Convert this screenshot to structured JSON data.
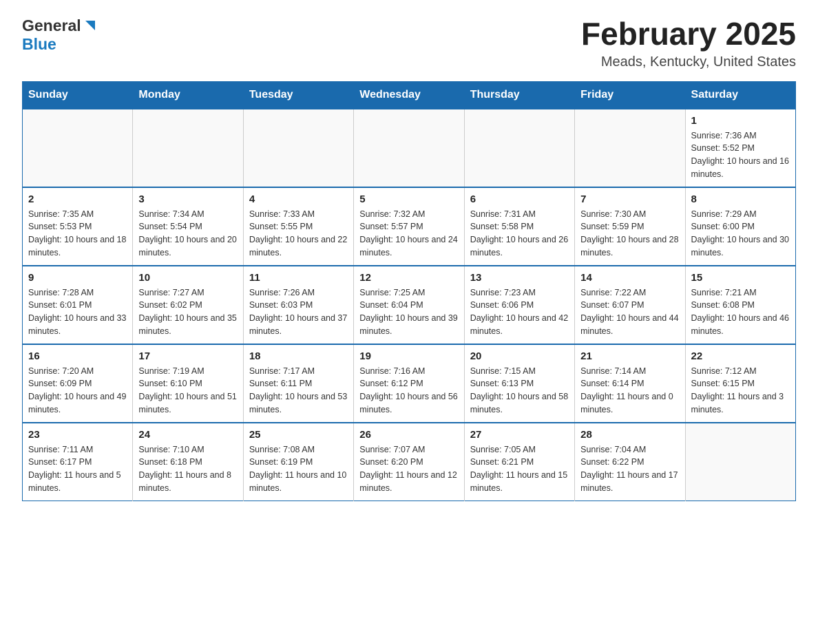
{
  "header": {
    "logo_general": "General",
    "logo_blue": "Blue",
    "month_title": "February 2025",
    "location": "Meads, Kentucky, United States"
  },
  "days_of_week": [
    "Sunday",
    "Monday",
    "Tuesday",
    "Wednesday",
    "Thursday",
    "Friday",
    "Saturday"
  ],
  "weeks": [
    [
      {
        "day": "",
        "info": ""
      },
      {
        "day": "",
        "info": ""
      },
      {
        "day": "",
        "info": ""
      },
      {
        "day": "",
        "info": ""
      },
      {
        "day": "",
        "info": ""
      },
      {
        "day": "",
        "info": ""
      },
      {
        "day": "1",
        "info": "Sunrise: 7:36 AM\nSunset: 5:52 PM\nDaylight: 10 hours and 16 minutes."
      }
    ],
    [
      {
        "day": "2",
        "info": "Sunrise: 7:35 AM\nSunset: 5:53 PM\nDaylight: 10 hours and 18 minutes."
      },
      {
        "day": "3",
        "info": "Sunrise: 7:34 AM\nSunset: 5:54 PM\nDaylight: 10 hours and 20 minutes."
      },
      {
        "day": "4",
        "info": "Sunrise: 7:33 AM\nSunset: 5:55 PM\nDaylight: 10 hours and 22 minutes."
      },
      {
        "day": "5",
        "info": "Sunrise: 7:32 AM\nSunset: 5:57 PM\nDaylight: 10 hours and 24 minutes."
      },
      {
        "day": "6",
        "info": "Sunrise: 7:31 AM\nSunset: 5:58 PM\nDaylight: 10 hours and 26 minutes."
      },
      {
        "day": "7",
        "info": "Sunrise: 7:30 AM\nSunset: 5:59 PM\nDaylight: 10 hours and 28 minutes."
      },
      {
        "day": "8",
        "info": "Sunrise: 7:29 AM\nSunset: 6:00 PM\nDaylight: 10 hours and 30 minutes."
      }
    ],
    [
      {
        "day": "9",
        "info": "Sunrise: 7:28 AM\nSunset: 6:01 PM\nDaylight: 10 hours and 33 minutes."
      },
      {
        "day": "10",
        "info": "Sunrise: 7:27 AM\nSunset: 6:02 PM\nDaylight: 10 hours and 35 minutes."
      },
      {
        "day": "11",
        "info": "Sunrise: 7:26 AM\nSunset: 6:03 PM\nDaylight: 10 hours and 37 minutes."
      },
      {
        "day": "12",
        "info": "Sunrise: 7:25 AM\nSunset: 6:04 PM\nDaylight: 10 hours and 39 minutes."
      },
      {
        "day": "13",
        "info": "Sunrise: 7:23 AM\nSunset: 6:06 PM\nDaylight: 10 hours and 42 minutes."
      },
      {
        "day": "14",
        "info": "Sunrise: 7:22 AM\nSunset: 6:07 PM\nDaylight: 10 hours and 44 minutes."
      },
      {
        "day": "15",
        "info": "Sunrise: 7:21 AM\nSunset: 6:08 PM\nDaylight: 10 hours and 46 minutes."
      }
    ],
    [
      {
        "day": "16",
        "info": "Sunrise: 7:20 AM\nSunset: 6:09 PM\nDaylight: 10 hours and 49 minutes."
      },
      {
        "day": "17",
        "info": "Sunrise: 7:19 AM\nSunset: 6:10 PM\nDaylight: 10 hours and 51 minutes."
      },
      {
        "day": "18",
        "info": "Sunrise: 7:17 AM\nSunset: 6:11 PM\nDaylight: 10 hours and 53 minutes."
      },
      {
        "day": "19",
        "info": "Sunrise: 7:16 AM\nSunset: 6:12 PM\nDaylight: 10 hours and 56 minutes."
      },
      {
        "day": "20",
        "info": "Sunrise: 7:15 AM\nSunset: 6:13 PM\nDaylight: 10 hours and 58 minutes."
      },
      {
        "day": "21",
        "info": "Sunrise: 7:14 AM\nSunset: 6:14 PM\nDaylight: 11 hours and 0 minutes."
      },
      {
        "day": "22",
        "info": "Sunrise: 7:12 AM\nSunset: 6:15 PM\nDaylight: 11 hours and 3 minutes."
      }
    ],
    [
      {
        "day": "23",
        "info": "Sunrise: 7:11 AM\nSunset: 6:17 PM\nDaylight: 11 hours and 5 minutes."
      },
      {
        "day": "24",
        "info": "Sunrise: 7:10 AM\nSunset: 6:18 PM\nDaylight: 11 hours and 8 minutes."
      },
      {
        "day": "25",
        "info": "Sunrise: 7:08 AM\nSunset: 6:19 PM\nDaylight: 11 hours and 10 minutes."
      },
      {
        "day": "26",
        "info": "Sunrise: 7:07 AM\nSunset: 6:20 PM\nDaylight: 11 hours and 12 minutes."
      },
      {
        "day": "27",
        "info": "Sunrise: 7:05 AM\nSunset: 6:21 PM\nDaylight: 11 hours and 15 minutes."
      },
      {
        "day": "28",
        "info": "Sunrise: 7:04 AM\nSunset: 6:22 PM\nDaylight: 11 hours and 17 minutes."
      },
      {
        "day": "",
        "info": ""
      }
    ]
  ]
}
